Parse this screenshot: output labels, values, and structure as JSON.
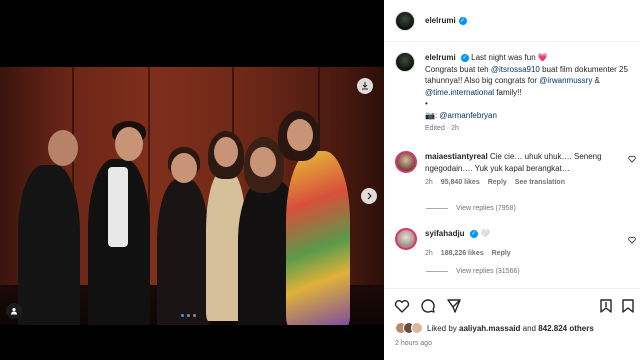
{
  "post": {
    "username": "elelrumi",
    "verified_badge": "✓",
    "photo": {
      "carousel_dots": 3,
      "active_dot": 0
    }
  },
  "caption": {
    "username": "elelrumi",
    "line1": "Last night was fun 💗",
    "line2_prefix": "Congrats buat teh ",
    "mention1": "@itsrossa910",
    "line2_suffix": " buat film dokumenter 25 tahunnya!! Also big congrats for ",
    "mention2": "@irwanmussry",
    "amp": " & ",
    "mention3": "@time.international",
    "line3_suffix": " family!!",
    "bullet": "•",
    "camera": "📷: ",
    "mention4": "@armanfebryan",
    "edited": "Edited · 2h"
  },
  "comments": [
    {
      "username": "maiaestiantyreal",
      "text": "Cie cie… uhuk uhuk…. Seneng ngegodain…. Yuk yuk kapal berangkat…",
      "time": "2h",
      "likes": "95,840 likes",
      "reply": "Reply",
      "translate": "See translation",
      "view_replies": "View replies (7958)"
    },
    {
      "username": "syifahadju",
      "text": "🤍",
      "time": "2h",
      "likes": "188,226 likes",
      "reply": "Reply",
      "view_replies": "View replies (31566)"
    }
  ],
  "likes": {
    "prefix": "Liked by ",
    "user": "aaliyah.massaid",
    "middle": " and ",
    "count": "842.824 others"
  },
  "timestamp": "2 hours ago",
  "colors": {
    "accent": "#0095f6",
    "mention": "#00376b",
    "muted": "#737373"
  }
}
